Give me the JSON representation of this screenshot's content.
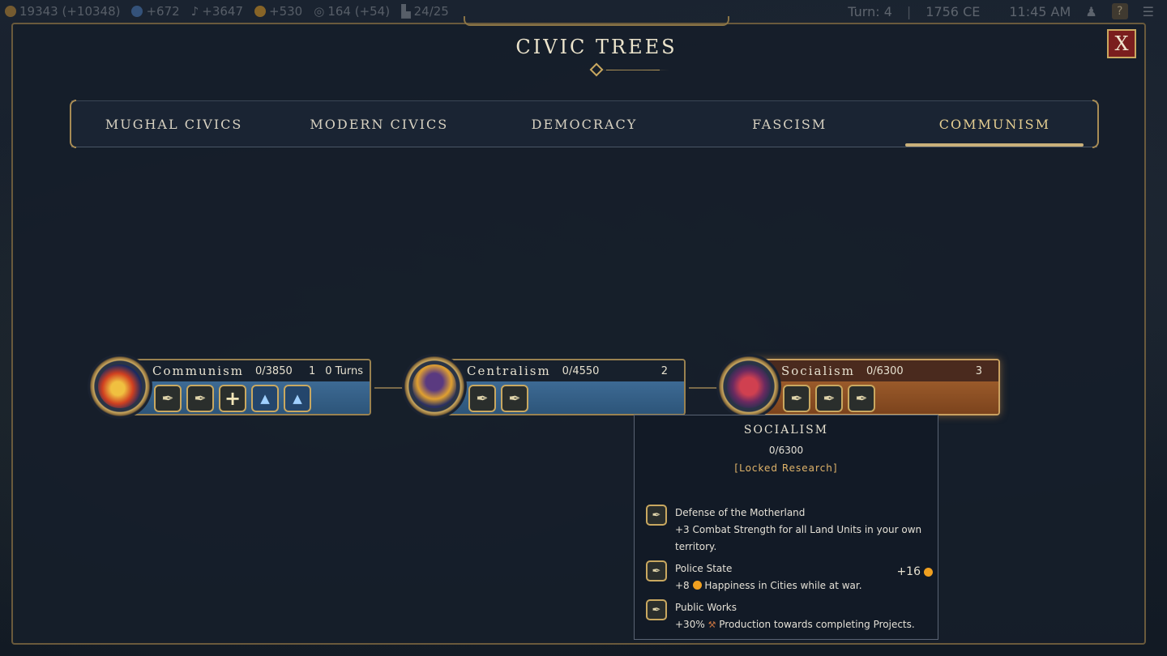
{
  "topbar": {
    "gold": "19343 (+10348)",
    "science": "+672",
    "culture": "+3647",
    "happiness": "+530",
    "influence": "164 (+54)",
    "production": "24/25",
    "turn": "Turn: 4",
    "year": "1756 CE",
    "time": "11:45 AM",
    "help_label": "?"
  },
  "dialog": {
    "title": "CIVIC TREES",
    "close_label": "X"
  },
  "tabs": [
    {
      "label": "MUGHAL CIVICS"
    },
    {
      "label": "MODERN CIVICS"
    },
    {
      "label": "DEMOCRACY"
    },
    {
      "label": "FASCISM"
    },
    {
      "label": "COMMUNISM"
    }
  ],
  "civics": [
    {
      "name": "Communism",
      "cost": "0/3850",
      "tier": "1",
      "turns": "0 Turns"
    },
    {
      "name": "Centralism",
      "cost": "0/4550",
      "tier": "2",
      "turns": ""
    },
    {
      "name": "Socialism",
      "cost": "0/6300",
      "tier": "3",
      "turns": ""
    }
  ],
  "tooltip": {
    "title": "SOCIALISM",
    "cost": "0/6300",
    "status": "[Locked Research]",
    "items": [
      {
        "name": "Defense of the Motherland",
        "desc": "+3 Combat Strength for all Land Units in your own territory."
      },
      {
        "name": "Police State",
        "desc_prefix": "+8",
        "desc_suffix": "Happiness in Cities while at war."
      },
      {
        "name": "Public Works",
        "desc_prefix": "+30%",
        "desc_suffix": "Production towards completing Projects."
      }
    ],
    "bonus": "+16"
  },
  "colors": {
    "accent_gold": "#c9a860",
    "active_tab": "#e6cf92",
    "node_blue": "#3d6a94",
    "node_orange": "#9a5a2a",
    "locked": "#e0b46a"
  }
}
